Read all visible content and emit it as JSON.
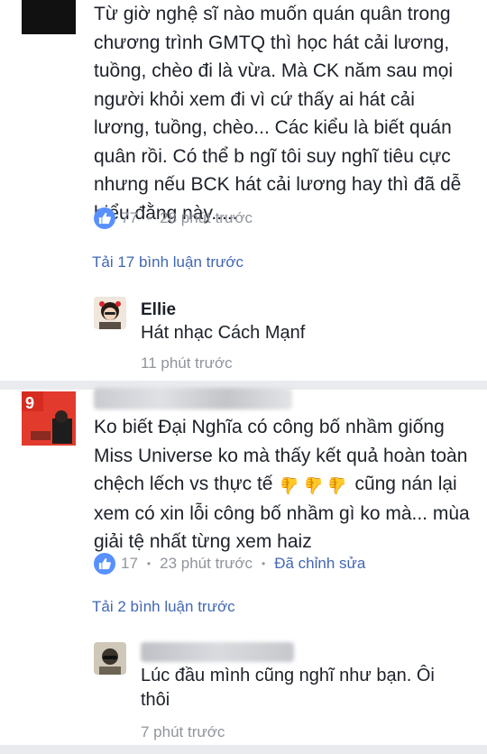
{
  "comment1": {
    "name_partial": "",
    "text": "Từ giờ nghệ sĩ nào muốn quán quân trong chương trình GMTQ thì học hát cải lương, tuồng, chèo đi là vừa. Mà CK năm sau mọi người khỏi xem đi vì cứ thấy ai hát cải lương, tuồng, chèo... Các kiểu là biết quán quân rồi. Có thể b ngĩ tôi suy nghĩ tiêu cực nhưng nếu BCK hát cải lương hay thì đã dễ hiểu đằng này.....",
    "likes": "77",
    "time": "28 phút trước",
    "load_more": "Tải 17 bình luận trước",
    "reply": {
      "name": "Ellie",
      "text": "Hát nhạc Cách Mạnf",
      "time": "11 phút trước"
    }
  },
  "comment2": {
    "text_before": "Ko biết Đại Nghĩa có công bố nhầm giống Miss Universe ko mà thấy kết quả hoàn toàn chệch lếch vs thực tế",
    "text_after": "cũng nán lại xem có xin lỗi công bố nhầm gì ko mà... mùa giải tệ nhất từng xem haiz",
    "likes": "17",
    "time": "23 phút trước",
    "edited": "Đã chỉnh sửa",
    "load_more": "Tải 2 bình luận trước",
    "reply": {
      "text": "Lúc đầu mình cũng nghĩ như bạn. Ôi thôi",
      "time": "7 phút trước"
    }
  },
  "colors": {
    "link": "#4267b2",
    "meta": "#90949c",
    "like": "#5890ff"
  },
  "icons": {
    "like": "like-icon",
    "thumb_down": "thumbs-down-icon"
  }
}
